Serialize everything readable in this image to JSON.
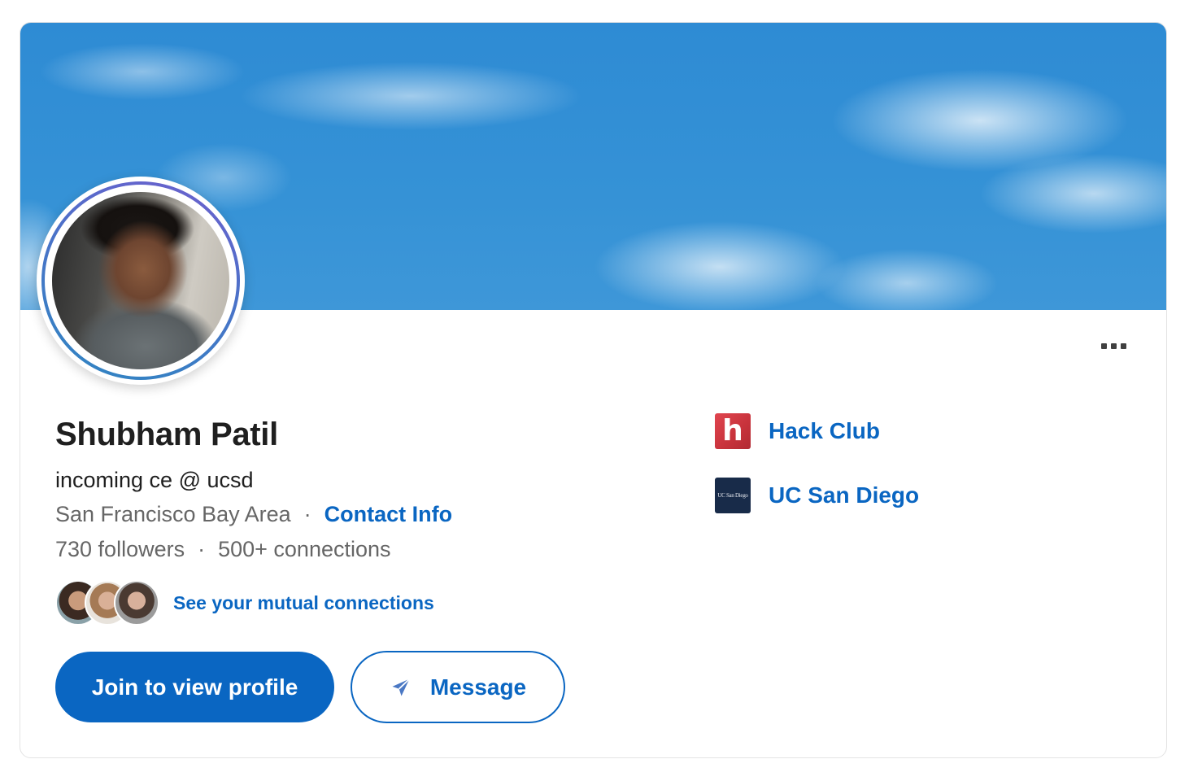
{
  "profile": {
    "name": "Shubham Patil",
    "headline": "incoming ce @ ucsd",
    "location": "San Francisco Bay Area",
    "separator": "·",
    "contact_info": "Contact Info",
    "followers": "730 followers",
    "connections": "500+ connections",
    "mutual_link": "See your mutual connections"
  },
  "actions": {
    "join_label": "Join to view profile",
    "message_label": "Message",
    "more_icon": "ellipsis-icon"
  },
  "organizations": [
    {
      "name": "Hack Club",
      "logo_text": "h",
      "logo_color": "#d63a44"
    },
    {
      "name": "UC San Diego",
      "logo_text": "UC San Diego",
      "logo_color": "#182b49"
    }
  ],
  "colors": {
    "accent": "#0a66c2",
    "cover_sky": "#3592d6",
    "name_text": "#1f1f1f",
    "meta_text": "#666666"
  },
  "icons": {
    "send": "send-icon",
    "more": "ellipsis-icon"
  }
}
